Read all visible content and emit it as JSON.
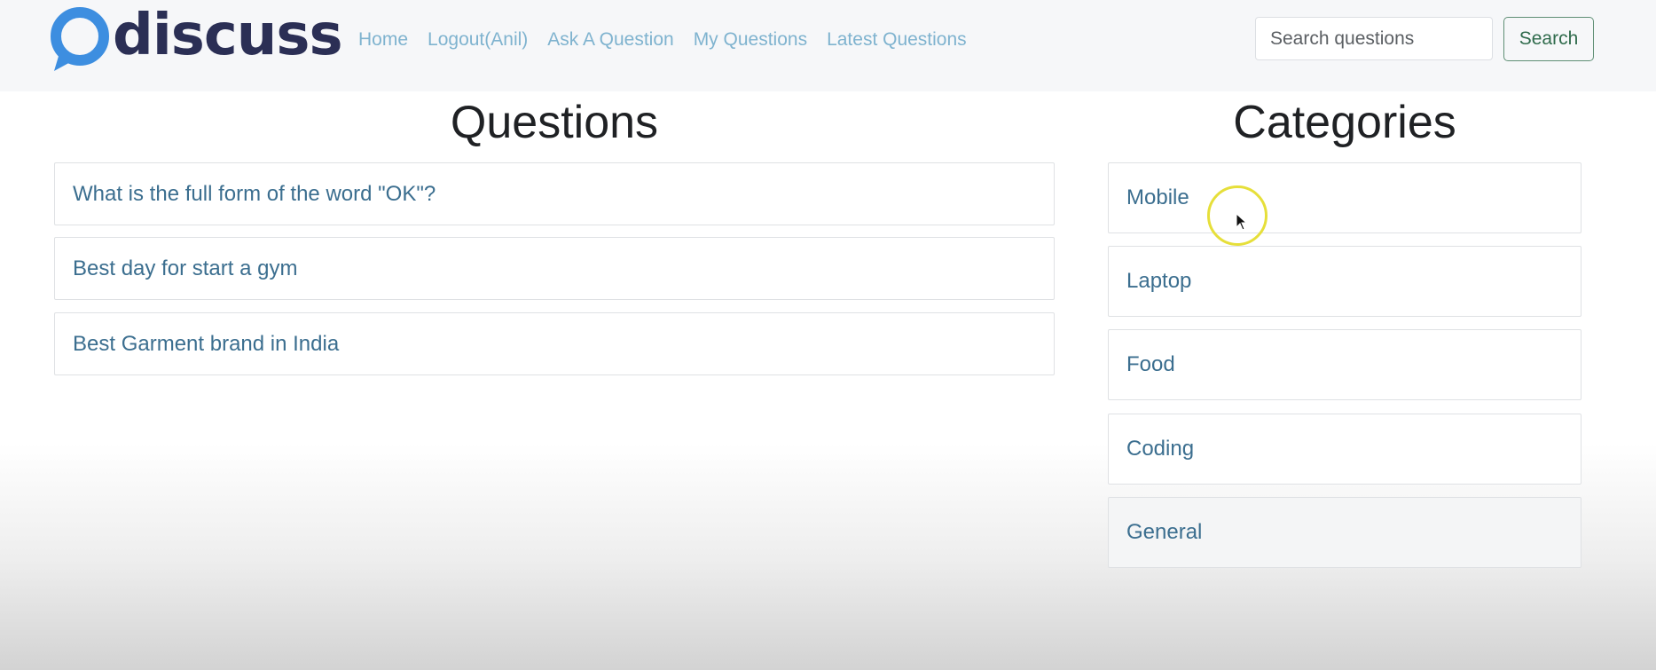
{
  "navbar": {
    "logo_text": "discuss",
    "logo_icon": "speech-bubble-icon",
    "links": [
      "Home",
      "Logout(Anil)",
      "Ask A Question",
      "My Questions",
      "Latest Questions"
    ],
    "search_placeholder": "Search questions",
    "search_value": "",
    "search_button_label": "Search"
  },
  "questions": {
    "title": "Questions",
    "items": [
      "What is the full form of the word \"OK\"?",
      "Best day for start a gym",
      "Best Garment brand in India"
    ]
  },
  "categories": {
    "title": "Categories",
    "items": [
      "Mobile",
      "Laptop",
      "Food",
      "Coding",
      "General"
    ]
  },
  "colors": {
    "nav_link": "#7fb3cf",
    "item_text": "#3b6e8f",
    "logo_blue": "#3d8ee0",
    "logo_text": "#2b2f55",
    "search_button": "#2f6b4c",
    "cursor_highlight": "#e6df3a"
  }
}
